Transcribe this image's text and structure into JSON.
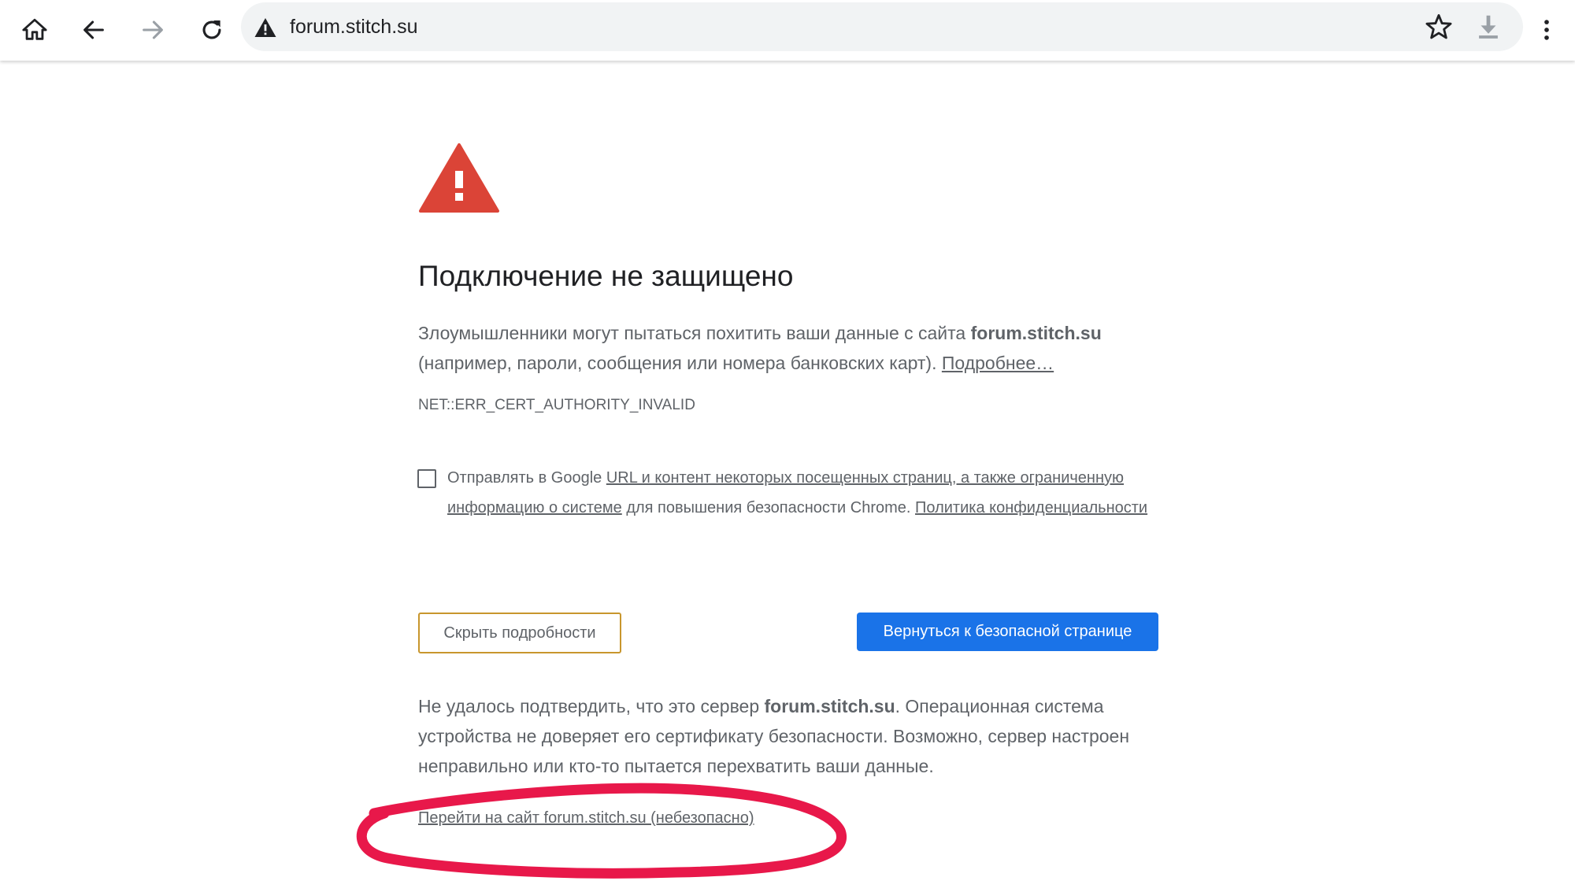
{
  "browser": {
    "url": "forum.stitch.su",
    "icons": {
      "home": "home-icon",
      "back": "arrow-back-icon",
      "forward": "arrow-forward-icon",
      "reload": "reload-icon",
      "security": "warning-triangle-icon",
      "bookmark": "star-outline-icon",
      "download": "download-icon",
      "menu": "more-vert-icon"
    }
  },
  "page": {
    "heading": "Подключение не защищено",
    "main_text_part1": "Злоумышленники могут пытаться похитить ваши данные с сайта",
    "main_text_host": "forum.stitch.su",
    "main_text_part2": "(например, пароли, сообщения или номера банковских карт).",
    "learn_more": "Подробнее…",
    "error_code": "NET::ERR_CERT_AUTHORITY_INVALID",
    "optin": {
      "prefix": "Отправлять в Google",
      "link1": "URL и контент некоторых посещенных страниц, а также ограниченную информацию о системе",
      "middle": "для повышения безопасности Chrome.",
      "link2": "Политика конфиденциальности",
      "checked": false
    },
    "details_button": "Скрыть подробности",
    "back_button": "Вернуться к безопасной странице",
    "details": {
      "part1": "Не удалось подтвердить, что это сервер",
      "host": "forum.stitch.su",
      "part2": ". Операционная система устройства не доверяет его сертификату безопасности. Возможно, сервер настроен неправильно или кто-то пытается перехватить ваши данные."
    },
    "proceed_link": "Перейти на сайт forum.stitch.su (небезопасно)"
  },
  "colors": {
    "danger_red": "#db4437",
    "primary_blue": "#1a73e8",
    "annotation_pink": "#e8184a",
    "focus_outline": "#c8962d"
  }
}
